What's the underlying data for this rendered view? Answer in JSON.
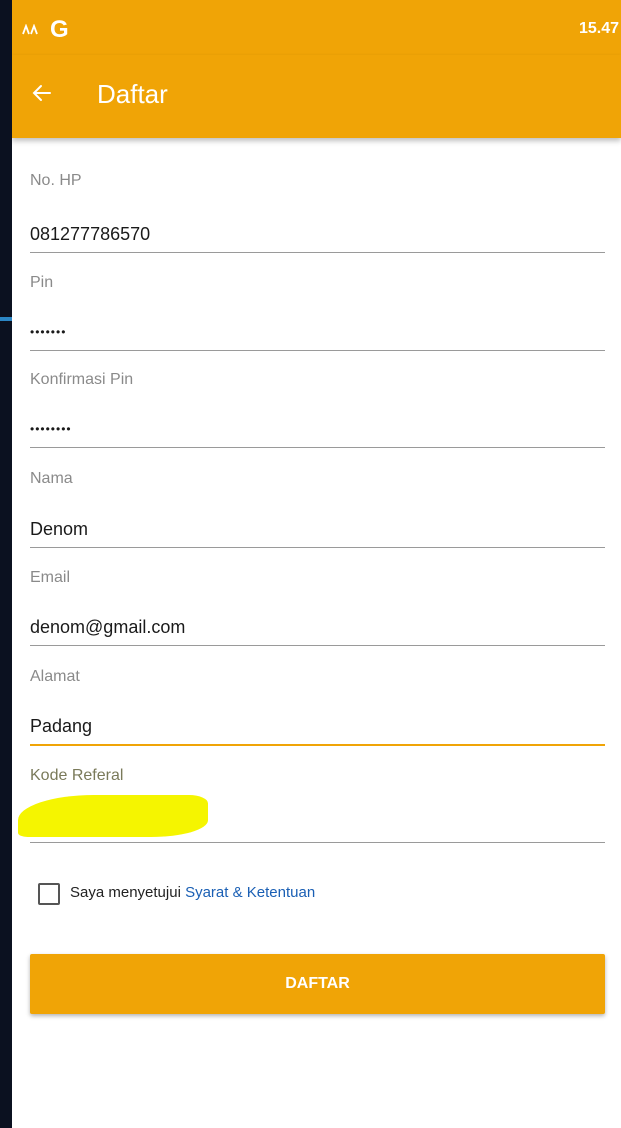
{
  "status_bar": {
    "app_icon": "google-icon",
    "g_label": "G",
    "time": "15.47"
  },
  "appbar": {
    "back_icon": "arrow-left-icon",
    "title": "Daftar"
  },
  "form": {
    "no_hp": {
      "label": "No. HP",
      "value": "081277786570"
    },
    "pin": {
      "label": "Pin",
      "value": "•••••••"
    },
    "confirm_pin": {
      "label": "Konfirmasi Pin",
      "value": "••••••••"
    },
    "nama": {
      "label": "Nama",
      "value": "Denom"
    },
    "email": {
      "label": "Email",
      "value": "denom@gmail.com"
    },
    "alamat": {
      "label": "Alamat",
      "value": "Padang"
    },
    "kode_referal": {
      "label": "Kode Referal",
      "value": ""
    }
  },
  "agreement": {
    "text": "Saya menyetujui",
    "link": "Syarat & Ketentuan",
    "checked": false
  },
  "submit_label": "DAFTAR",
  "colors": {
    "accent": "#f0a406",
    "link": "#1a5fb4",
    "highlight": "#f5f500"
  }
}
